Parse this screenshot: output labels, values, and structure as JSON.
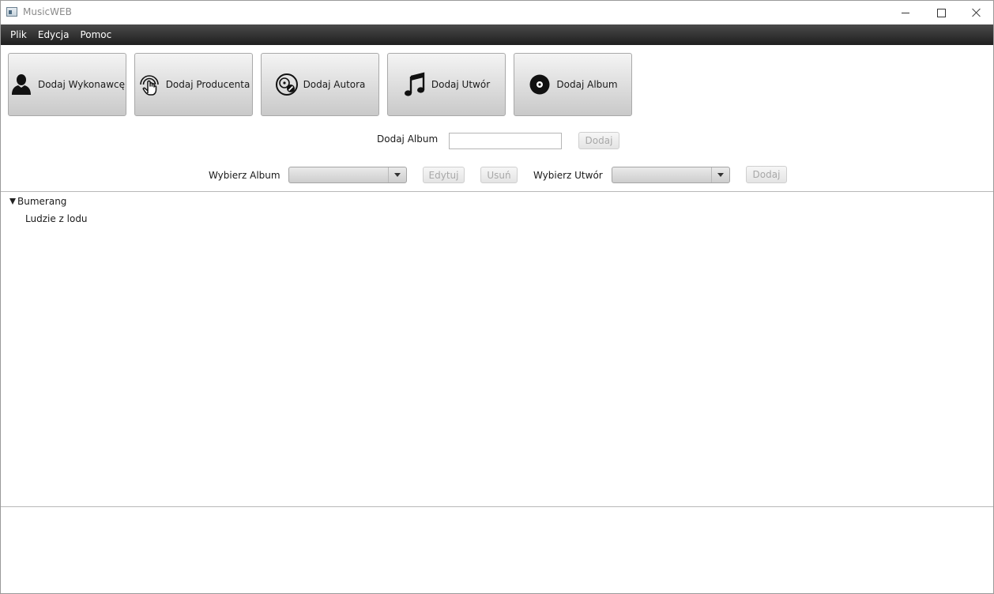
{
  "window": {
    "title": "MusicWEB"
  },
  "menu": [
    "Plik",
    "Edycja",
    "Pomoc"
  ],
  "toolbar": {
    "buttons": [
      {
        "label": "Dodaj Wykonawcę",
        "icon": "person-icon"
      },
      {
        "label": "Dodaj Producenta",
        "icon": "touch-hand-icon"
      },
      {
        "label": "Dodaj Autora",
        "icon": "disc-pen-icon"
      },
      {
        "label": "Dodaj Utwór",
        "icon": "music-note-icon"
      },
      {
        "label": "Dodaj Album",
        "icon": "vinyl-disc-icon"
      }
    ]
  },
  "add_album": {
    "label": "Dodaj Album",
    "value": "",
    "button": "Dodaj"
  },
  "select_row": {
    "album_label": "Wybierz Album",
    "album_value": "",
    "edit_button": "Edytuj",
    "delete_button": "Usuń",
    "track_label": "Wybierz Utwór",
    "track_value": "",
    "add_button": "Dodaj"
  },
  "tree": {
    "root": {
      "label": "Bumerang",
      "expanded": true
    },
    "children": [
      "Ludzie z lodu"
    ]
  }
}
